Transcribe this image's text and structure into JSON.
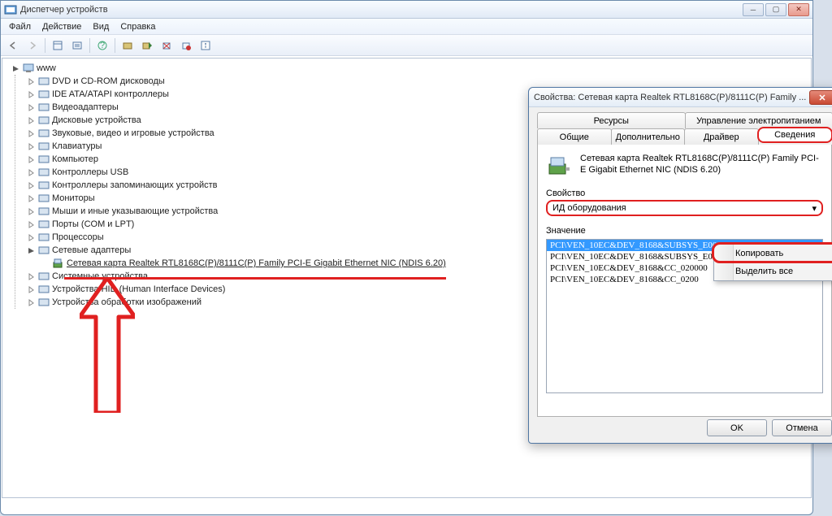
{
  "mainWindow": {
    "title": "Диспетчер устройств",
    "menu": {
      "file": "Файл",
      "action": "Действие",
      "view": "Вид",
      "help": "Справка"
    },
    "root": "www",
    "categories": [
      "DVD и CD-ROM дисководы",
      "IDE ATA/ATAPI контроллеры",
      "Видеоадаптеры",
      "Дисковые устройства",
      "Звуковые, видео и игровые устройства",
      "Клавиатуры",
      "Компьютер",
      "Контроллеры USB",
      "Контроллеры запоминающих устройств",
      "Мониторы",
      "Мыши и иные указывающие устройства",
      "Порты (COM и LPT)",
      "Процессоры",
      "Сетевые адаптеры",
      "Системные устройства",
      "Устройства HID (Human Interface Devices)",
      "Устройства обработки изображений"
    ],
    "networkDevice": "Сетевая карта Realtek RTL8168C(P)/8111C(P) Family PCI-E Gigabit Ethernet NIC (NDIS 6.20)"
  },
  "props": {
    "title": "Свойства: Сетевая карта Realtek RTL8168C(P)/8111C(P) Family ...",
    "tabsTop": {
      "resources": "Ресурсы",
      "power": "Управление электропитанием"
    },
    "tabsBottom": {
      "general": "Общие",
      "advanced": "Дополнительно",
      "driver": "Драйвер",
      "details": "Сведения"
    },
    "deviceName": "Сетевая карта Realtek RTL8168C(P)/8111C(P) Family PCI-E Gigabit Ethernet NIC (NDIS 6.20)",
    "propertyLabel": "Свойство",
    "propertyValue": "ИД оборудования",
    "valueLabel": "Значение",
    "values": [
      "PCI\\VEN_10EC&DEV_8168&SUBSYS_E00014",
      "PCI\\VEN_10EC&DEV_8168&SUBSYS_E00014",
      "PCI\\VEN_10EC&DEV_8168&CC_020000",
      "PCI\\VEN_10EC&DEV_8168&CC_0200"
    ],
    "ok": "OK",
    "cancel": "Отмена"
  },
  "contextMenu": {
    "copy": "Копировать",
    "selectAll": "Выделить все"
  }
}
